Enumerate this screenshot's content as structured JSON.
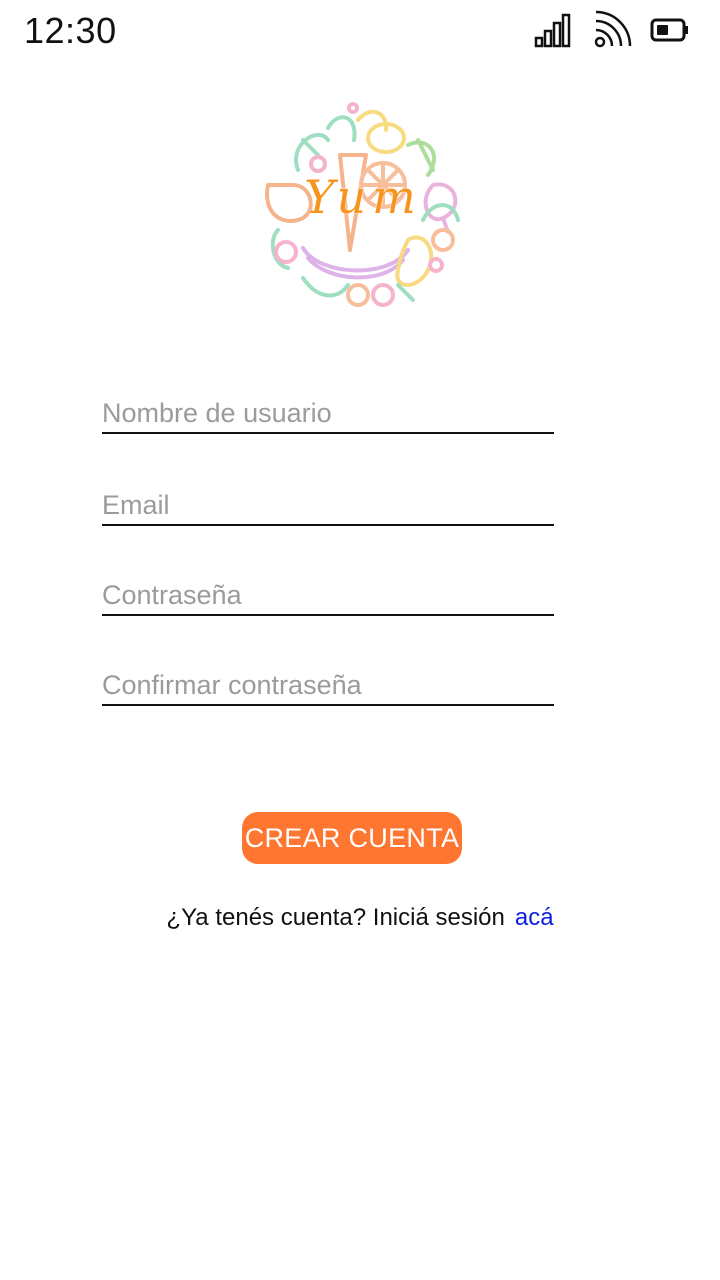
{
  "status_bar": {
    "time": "12:30",
    "icons": [
      "signal-icon",
      "wifi-icon",
      "battery-icon"
    ]
  },
  "logo": {
    "text": "Yum",
    "text_color": "#f7941d"
  },
  "form": {
    "username_placeholder": "Nombre de usuario",
    "email_placeholder": "Email",
    "password_placeholder": "Contraseña",
    "confirm_password_placeholder": "Confirmar contraseña"
  },
  "create_button": {
    "label": "CREAR CUENTA",
    "color": "#ff7630"
  },
  "login_prompt": {
    "text": "¿Ya tenés cuenta? Iniciá sesión",
    "link_label": "acá",
    "link_color": "#0a1fdc"
  }
}
